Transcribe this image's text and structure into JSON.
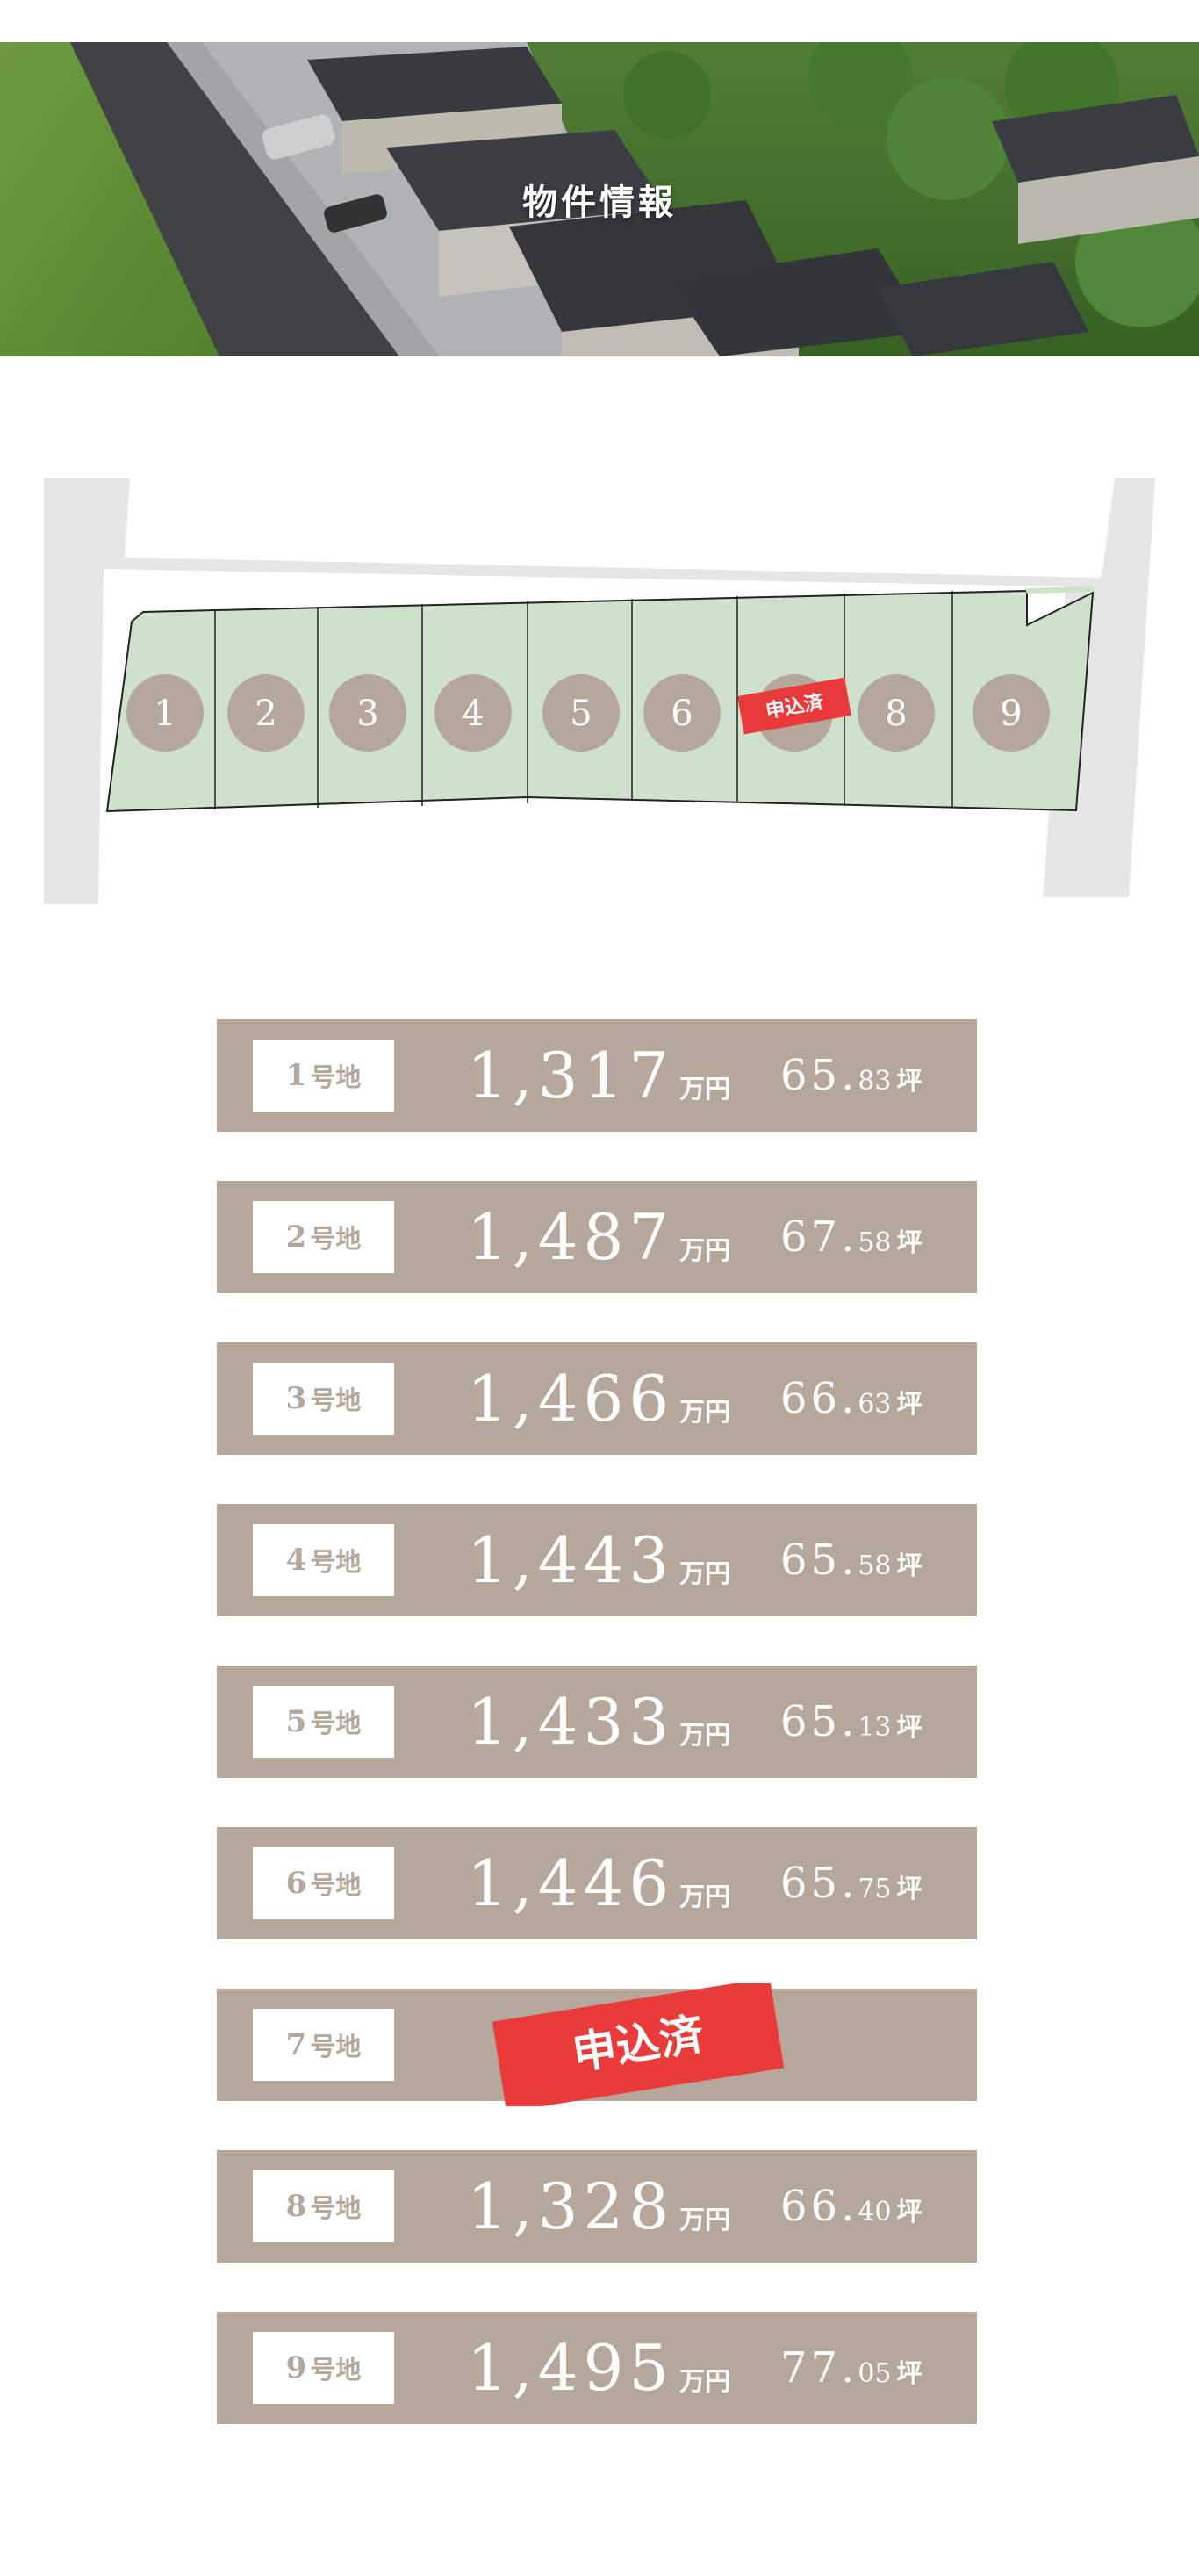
{
  "hero": {
    "title": "物件情報"
  },
  "site_plan": {
    "lots": [
      {
        "no": "1",
        "status": ""
      },
      {
        "no": "2",
        "status": ""
      },
      {
        "no": "3",
        "status": ""
      },
      {
        "no": "4",
        "status": ""
      },
      {
        "no": "5",
        "status": ""
      },
      {
        "no": "6",
        "status": ""
      },
      {
        "no": "7",
        "status": "申込済"
      },
      {
        "no": "8",
        "status": ""
      },
      {
        "no": "9",
        "status": ""
      }
    ],
    "sold_badge": "申込済"
  },
  "labels": {
    "lot_suffix": "号地",
    "price_unit": "万円",
    "area_unit": "坪"
  },
  "colors": {
    "row_bg": "#b5a79c",
    "lot_green": "#cfe0cc",
    "road": "#e6e6e6",
    "sold_red": "#e83a3a"
  },
  "lots": [
    {
      "no": "1",
      "price": "1,317",
      "area_int": "65.",
      "area_dec": "83",
      "sold": false
    },
    {
      "no": "2",
      "price": "1,487",
      "area_int": "67.",
      "area_dec": "58",
      "sold": false
    },
    {
      "no": "3",
      "price": "1,466",
      "area_int": "66.",
      "area_dec": "63",
      "sold": false
    },
    {
      "no": "4",
      "price": "1,443",
      "area_int": "65.",
      "area_dec": "58",
      "sold": false
    },
    {
      "no": "5",
      "price": "1,433",
      "area_int": "65.",
      "area_dec": "13",
      "sold": false
    },
    {
      "no": "6",
      "price": "1,446",
      "area_int": "65.",
      "area_dec": "75",
      "sold": false
    },
    {
      "no": "7",
      "price": "",
      "area_int": "",
      "area_dec": "",
      "sold": true,
      "status": "申込済"
    },
    {
      "no": "8",
      "price": "1,328",
      "area_int": "66.",
      "area_dec": "40",
      "sold": false
    },
    {
      "no": "9",
      "price": "1,495",
      "area_int": "77.",
      "area_dec": "05",
      "sold": false
    }
  ]
}
